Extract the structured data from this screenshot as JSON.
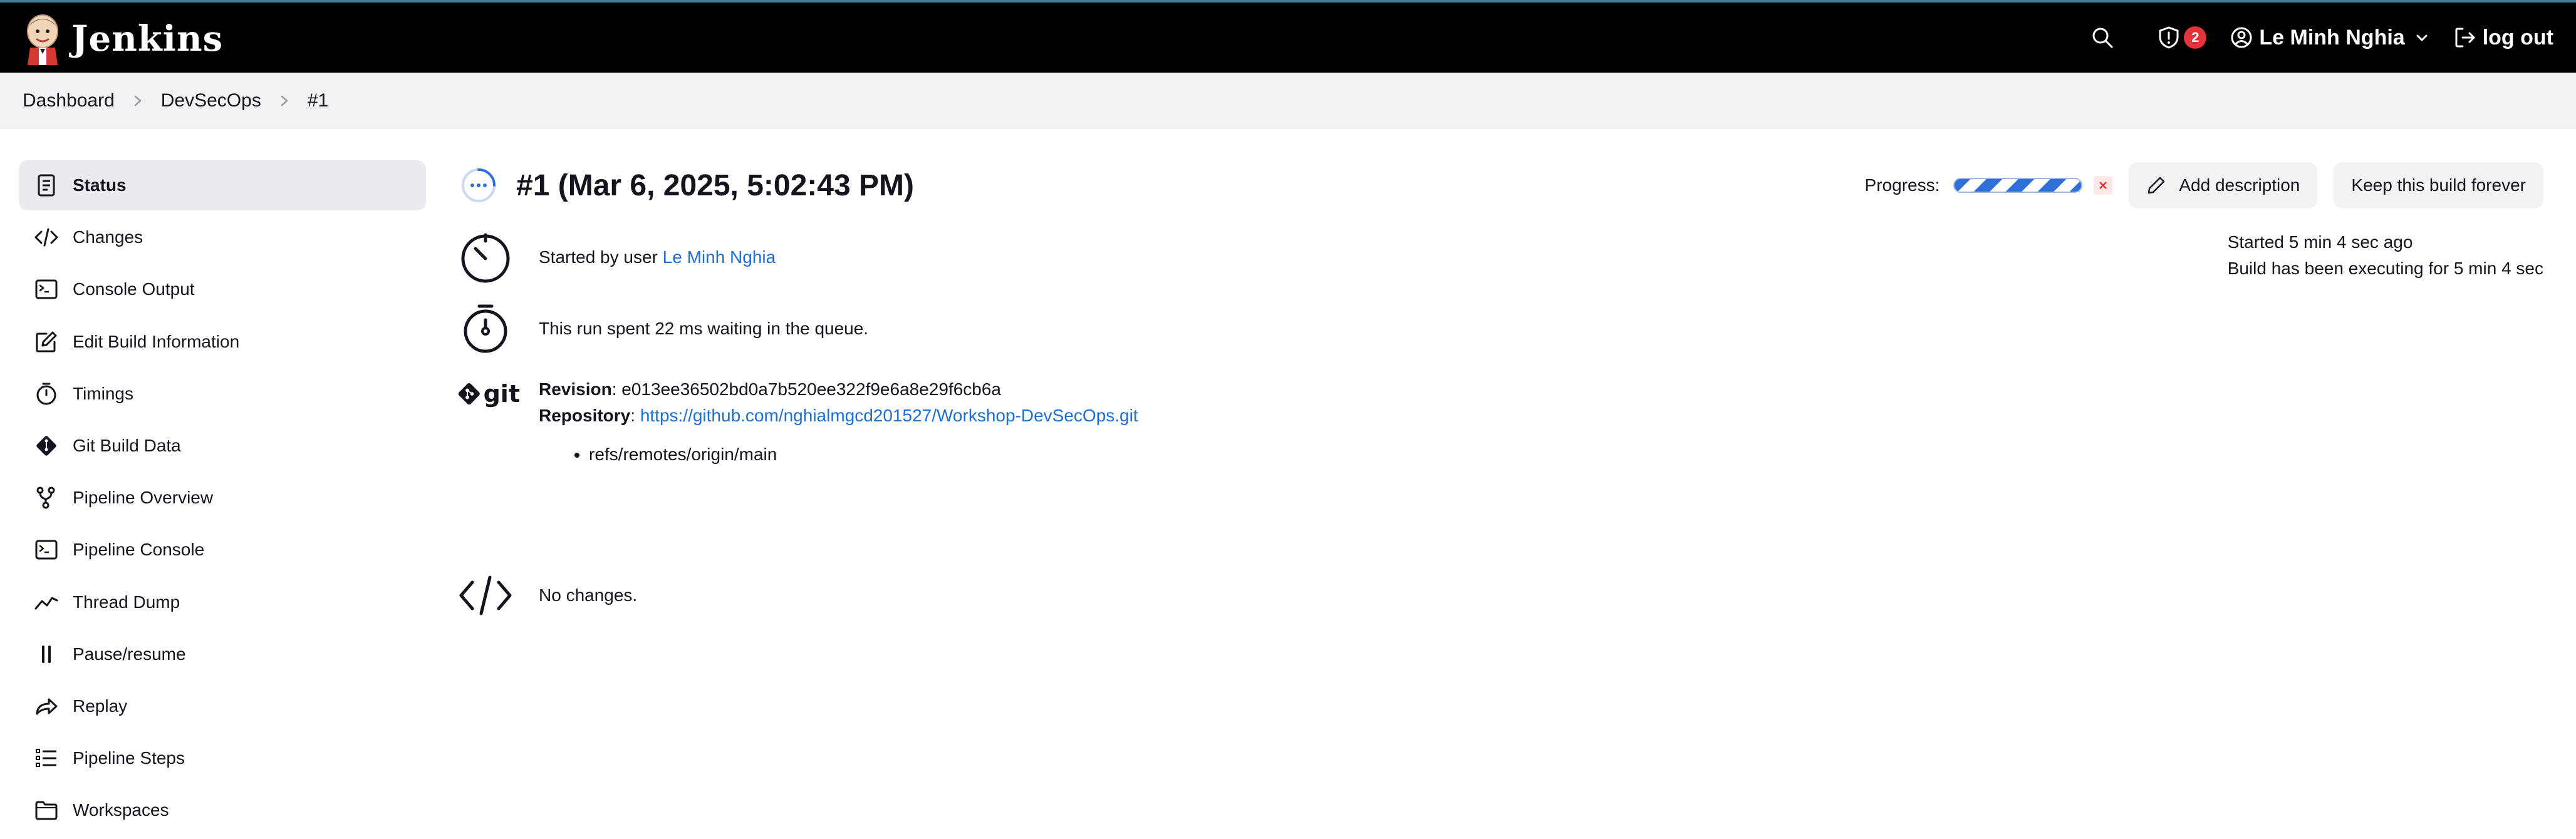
{
  "header": {
    "brand": "Jenkins",
    "security_count": "2",
    "user": "Le Minh Nghia",
    "logout": "log out"
  },
  "breadcrumb": [
    "Dashboard",
    "DevSecOps",
    "#1"
  ],
  "sidebar": {
    "items": [
      {
        "label": "Status",
        "icon": "document-icon"
      },
      {
        "label": "Changes",
        "icon": "code-icon"
      },
      {
        "label": "Console Output",
        "icon": "terminal-icon"
      },
      {
        "label": "Edit Build Information",
        "icon": "edit-icon"
      },
      {
        "label": "Timings",
        "icon": "stopwatch-icon"
      },
      {
        "label": "Git Build Data",
        "icon": "git-icon"
      },
      {
        "label": "Pipeline Overview",
        "icon": "branch-icon"
      },
      {
        "label": "Pipeline Console",
        "icon": "terminal-icon"
      },
      {
        "label": "Thread Dump",
        "icon": "trend-icon"
      },
      {
        "label": "Pause/resume",
        "icon": "pause-icon"
      },
      {
        "label": "Replay",
        "icon": "replay-icon"
      },
      {
        "label": "Pipeline Steps",
        "icon": "list-icon"
      },
      {
        "label": "Workspaces",
        "icon": "folder-icon"
      }
    ]
  },
  "main": {
    "title": "#1 (Mar 6, 2025, 5:02:43 PM)",
    "progress_label": "Progress:",
    "add_description": "Add description",
    "keep_forever": "Keep this build forever",
    "started_by_prefix": "Started by user ",
    "started_by_user": "Le Minh Nghia",
    "queue_text": "This run spent 22 ms waiting in the queue.",
    "git_logo_text": "git",
    "revision_label": "Revision",
    "revision_value": ": e013ee36502bd0a7b520ee322f9e6a8e29f6cb6a",
    "repository_label": "Repository",
    "repository_sep": ": ",
    "repository_url": "https://github.com/nghialmgcd201527/Workshop-DevSecOps.git",
    "refs": [
      "refs/remotes/origin/main"
    ],
    "no_changes": "No changes.",
    "started_ago": "Started 5 min 4 sec ago",
    "executing_for": "Build has been executing for 5 min 4 sec"
  },
  "colors": {
    "header_bg": "#000000",
    "link": "#1e6fd0",
    "badge": "#e5333a",
    "progress": "#2e6fd8"
  }
}
